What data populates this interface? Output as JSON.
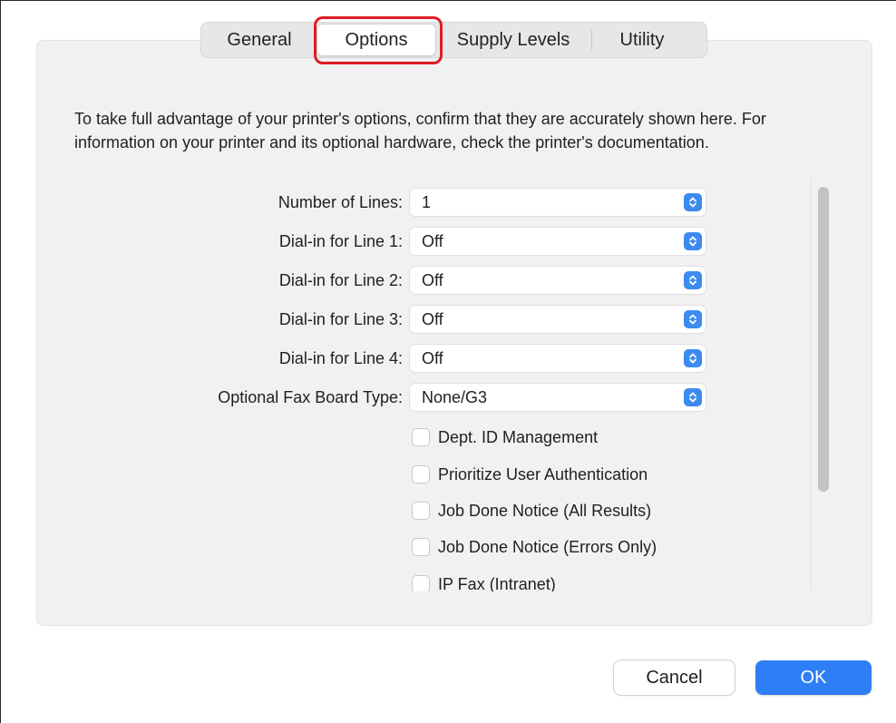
{
  "tabs": {
    "general": "General",
    "options": "Options",
    "supply_levels": "Supply Levels",
    "utility": "Utility",
    "selected": "Options"
  },
  "intro_text": "To take full advantage of your printer's options, confirm that they are accurately shown here. For information on your printer and its optional hardware, check the printer's documentation.",
  "fields": [
    {
      "label": "Number of Lines:",
      "value": "1"
    },
    {
      "label": "Dial-in for Line 1:",
      "value": "Off"
    },
    {
      "label": "Dial-in for Line 2:",
      "value": "Off"
    },
    {
      "label": "Dial-in for Line 3:",
      "value": "Off"
    },
    {
      "label": "Dial-in for Line 4:",
      "value": "Off"
    },
    {
      "label": "Optional Fax Board Type:",
      "value": "None/G3"
    }
  ],
  "checkboxes": [
    {
      "label": "Dept. ID Management",
      "checked": false
    },
    {
      "label": "Prioritize User Authentication",
      "checked": false
    },
    {
      "label": "Job Done Notice (All Results)",
      "checked": false
    },
    {
      "label": "Job Done Notice (Errors Only)",
      "checked": false
    },
    {
      "label": "IP Fax (Intranet)",
      "checked": false
    }
  ],
  "buttons": {
    "cancel": "Cancel",
    "ok": "OK"
  },
  "icons": {
    "select_stepper": "chevron-up-down-icon"
  },
  "colors": {
    "accent": "#2e7ff5",
    "stepper": "#3d8bf0",
    "highlight": "#e01b24"
  }
}
